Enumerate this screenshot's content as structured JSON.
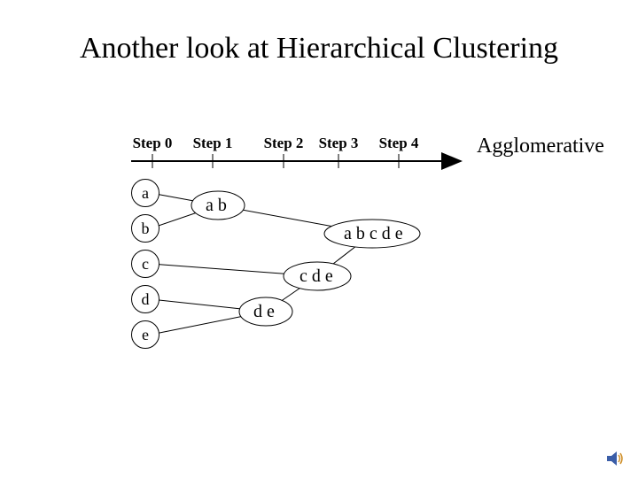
{
  "title": "Another look at Hierarchical Clustering",
  "steps": [
    "Step 0",
    "Step 1",
    "Step 2",
    "Step 3",
    "Step 4"
  ],
  "method_label": "Agglomerative",
  "leaves": [
    "a",
    "b",
    "c",
    "d",
    "e"
  ],
  "clusters": {
    "ab": "a b",
    "de": "d e",
    "cde": "c d e",
    "abcde": "a b c d e"
  },
  "icon": {
    "name": "speaker-icon"
  }
}
